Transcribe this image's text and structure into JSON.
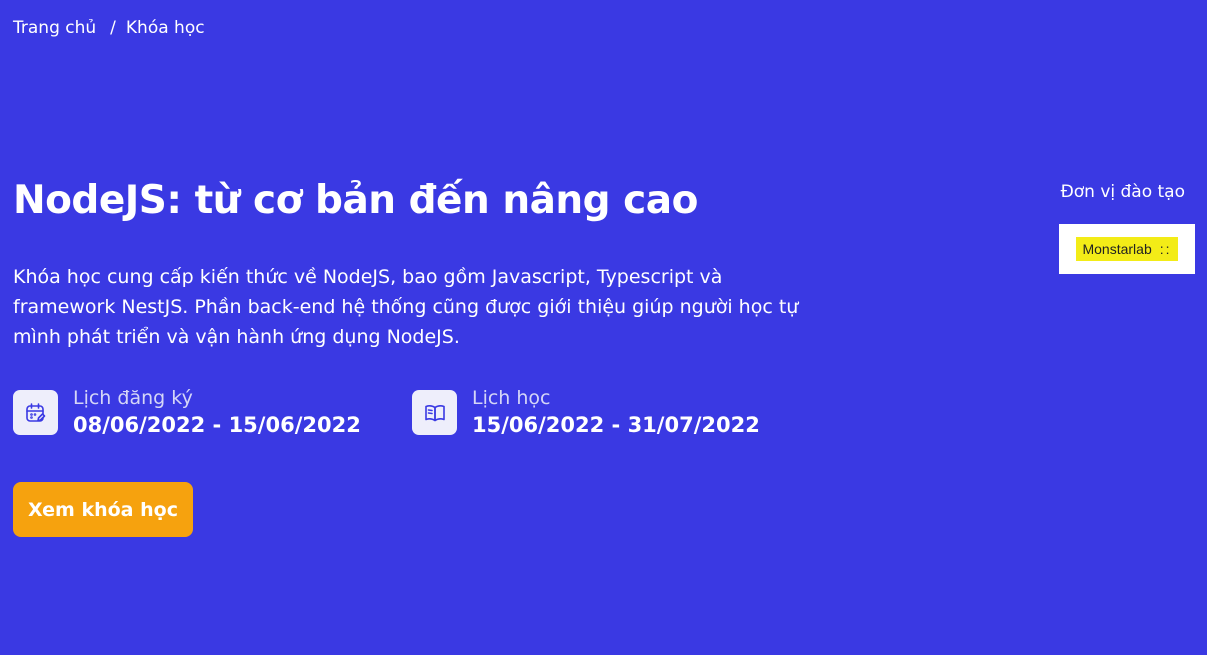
{
  "breadcrumb": {
    "home": "Trang chủ",
    "separator": "/",
    "current": "Khóa học"
  },
  "course": {
    "title": "NodeJS: từ cơ bản đến nâng cao",
    "description": "Khóa học cung cấp kiến thức về NodeJS, bao gồm Javascript, Typescript và framework NestJS. Phần back-end hệ thống cũng được giới thiệu giúp người học tự mình phát triển và vận hành ứng dụng NodeJS."
  },
  "registration": {
    "label": "Lịch đăng ký",
    "dates": "08/06/2022 - 15/06/2022",
    "icon": "calendar-edit-icon"
  },
  "schedule": {
    "label": "Lịch học",
    "dates": "15/06/2022 - 31/07/2022",
    "icon": "open-book-icon"
  },
  "cta": {
    "label": "Xem khóa học"
  },
  "provider": {
    "label": "Đơn vị đào tạo",
    "logo_text": "Monstarlab",
    "logo_mark": "::"
  },
  "colors": {
    "background": "#3a39e3",
    "button": "#f6a20e",
    "logo_bg": "#f3ec17"
  }
}
